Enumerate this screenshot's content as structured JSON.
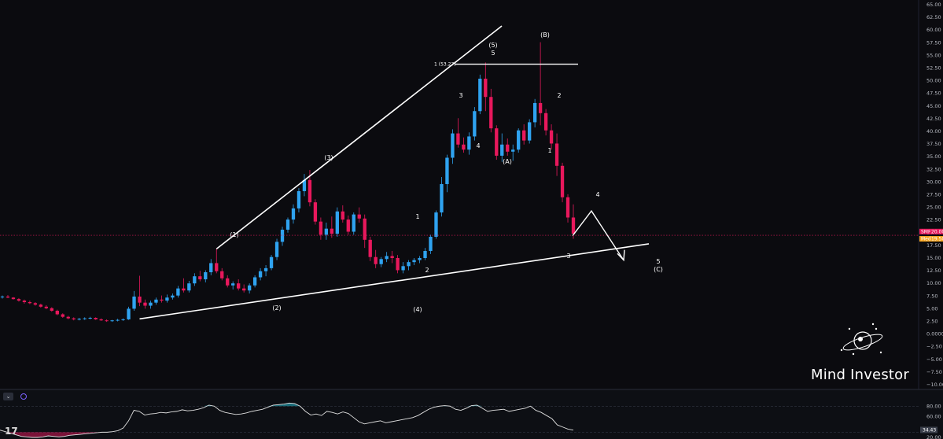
{
  "chart_data": [
    {
      "type": "candlestick",
      "ylim": [
        -10.0,
        65.0
      ],
      "y_ticks": [
        "65.00",
        "62.50",
        "60.00",
        "57.50",
        "55.00",
        "52.50",
        "50.00",
        "47.50",
        "45.00",
        "42.50",
        "40.00",
        "37.50",
        "35.00",
        "32.50",
        "30.00",
        "27.50",
        "25.00",
        "22.50",
        "20.00",
        "17.50",
        "15.00",
        "12.50",
        "10.00",
        "7.50",
        "5.00",
        "2.50",
        "0.0000",
        "−2.50",
        "−5.00",
        "−7.50",
        "−10.00"
      ],
      "up_color": "#2fa3f0",
      "down_color": "#e8185c",
      "candles": [
        [
          7.3,
          7.6,
          7.0,
          7.4
        ],
        [
          7.4,
          7.7,
          7.1,
          7.2
        ],
        [
          7.2,
          7.3,
          6.8,
          6.9
        ],
        [
          6.9,
          7.1,
          6.4,
          6.6
        ],
        [
          6.6,
          6.8,
          6.0,
          6.3
        ],
        [
          6.3,
          6.6,
          5.9,
          6.1
        ],
        [
          6.1,
          6.3,
          5.6,
          5.8
        ],
        [
          5.8,
          6.0,
          5.2,
          5.4
        ],
        [
          5.4,
          5.7,
          4.9,
          5.1
        ],
        [
          5.1,
          5.3,
          4.4,
          4.6
        ],
        [
          4.6,
          4.8,
          3.7,
          3.9
        ],
        [
          3.9,
          4.1,
          3.2,
          3.4
        ],
        [
          3.4,
          3.6,
          2.9,
          3.1
        ],
        [
          3.1,
          3.3,
          2.7,
          2.9
        ],
        [
          2.9,
          3.2,
          2.7,
          3.0
        ],
        [
          3.0,
          3.3,
          2.8,
          3.1
        ],
        [
          3.1,
          3.4,
          2.9,
          3.2
        ],
        [
          3.2,
          3.3,
          2.8,
          2.9
        ],
        [
          2.9,
          3.1,
          2.6,
          2.7
        ],
        [
          2.7,
          2.9,
          2.4,
          2.6
        ],
        [
          2.6,
          2.8,
          2.4,
          2.7
        ],
        [
          2.7,
          3.0,
          2.5,
          2.8
        ],
        [
          2.8,
          3.1,
          2.6,
          2.9
        ],
        [
          2.9,
          5.4,
          2.8,
          5.0
        ],
        [
          5.0,
          8.5,
          4.6,
          7.4
        ],
        [
          7.4,
          11.5,
          5.5,
          6.2
        ],
        [
          6.2,
          6.8,
          5.0,
          5.6
        ],
        [
          5.6,
          6.6,
          5.0,
          6.2
        ],
        [
          6.2,
          7.2,
          5.8,
          6.8
        ],
        [
          6.8,
          7.6,
          6.2,
          6.6
        ],
        [
          6.6,
          7.8,
          6.2,
          7.2
        ],
        [
          7.2,
          8.0,
          6.8,
          7.6
        ],
        [
          7.6,
          9.5,
          7.2,
          9.0
        ],
        [
          9.0,
          11.0,
          8.2,
          8.6
        ],
        [
          8.6,
          10.5,
          8.2,
          10.0
        ],
        [
          10.0,
          12.0,
          9.5,
          11.4
        ],
        [
          11.4,
          12.5,
          10.4,
          10.8
        ],
        [
          10.8,
          12.6,
          10.2,
          12.2
        ],
        [
          12.2,
          14.8,
          11.6,
          14.0
        ],
        [
          14.0,
          16.8,
          12.0,
          12.4
        ],
        [
          12.4,
          13.0,
          10.6,
          11.0
        ],
        [
          11.0,
          11.6,
          9.2,
          9.6
        ],
        [
          9.6,
          10.4,
          8.8,
          10.0
        ],
        [
          10.0,
          10.8,
          8.6,
          9.0
        ],
        [
          9.0,
          9.8,
          8.2,
          8.6
        ],
        [
          8.6,
          10.0,
          8.0,
          9.6
        ],
        [
          9.6,
          11.6,
          9.2,
          11.2
        ],
        [
          11.2,
          13.0,
          10.6,
          12.4
        ],
        [
          12.4,
          13.6,
          11.4,
          13.0
        ],
        [
          13.0,
          15.6,
          12.6,
          15.2
        ],
        [
          15.2,
          18.8,
          14.6,
          18.2
        ],
        [
          18.2,
          21.2,
          17.4,
          20.6
        ],
        [
          20.6,
          23.0,
          20.0,
          22.6
        ],
        [
          22.6,
          25.6,
          21.8,
          24.8
        ],
        [
          24.8,
          28.8,
          24.0,
          28.2
        ],
        [
          28.2,
          31.6,
          27.2,
          30.4
        ],
        [
          30.4,
          32.4,
          25.2,
          26.0
        ],
        [
          26.0,
          26.6,
          21.6,
          22.2
        ],
        [
          22.2,
          23.0,
          18.6,
          19.6
        ],
        [
          19.6,
          22.0,
          18.6,
          20.8
        ],
        [
          20.8,
          23.2,
          19.0,
          19.8
        ],
        [
          19.8,
          25.0,
          19.2,
          24.2
        ],
        [
          24.2,
          25.4,
          22.0,
          22.6
        ],
        [
          22.6,
          23.4,
          19.6,
          20.2
        ],
        [
          20.2,
          24.0,
          19.6,
          23.6
        ],
        [
          23.6,
          25.0,
          22.0,
          22.8
        ],
        [
          22.8,
          23.6,
          17.0,
          18.6
        ],
        [
          18.6,
          19.2,
          14.4,
          15.2
        ],
        [
          15.2,
          16.6,
          13.0,
          13.8
        ],
        [
          13.8,
          15.2,
          13.2,
          14.8
        ],
        [
          14.8,
          16.2,
          14.2,
          15.4
        ],
        [
          15.4,
          16.4,
          14.0,
          15.0
        ],
        [
          15.0,
          15.6,
          12.0,
          12.6
        ],
        [
          12.6,
          14.2,
          12.0,
          13.4
        ],
        [
          13.4,
          14.6,
          12.6,
          14.2
        ],
        [
          14.2,
          15.0,
          13.6,
          14.6
        ],
        [
          14.6,
          15.4,
          14.0,
          15.0
        ],
        [
          15.0,
          17.0,
          14.6,
          16.4
        ],
        [
          16.4,
          19.6,
          15.8,
          19.2
        ],
        [
          19.2,
          24.4,
          18.8,
          24.0
        ],
        [
          24.0,
          31.0,
          23.2,
          29.6
        ],
        [
          29.6,
          35.4,
          28.0,
          34.8
        ],
        [
          34.8,
          40.4,
          33.6,
          39.6
        ],
        [
          39.6,
          42.6,
          36.8,
          37.4
        ],
        [
          37.4,
          38.8,
          35.8,
          36.4
        ],
        [
          36.4,
          39.8,
          35.4,
          39.0
        ],
        [
          39.0,
          44.8,
          38.2,
          44.0
        ],
        [
          44.0,
          51.2,
          43.4,
          50.4
        ],
        [
          50.4,
          53.6,
          44.0,
          46.8
        ],
        [
          46.8,
          48.4,
          39.8,
          40.6
        ],
        [
          40.6,
          41.2,
          34.4,
          35.2
        ],
        [
          35.2,
          39.6,
          34.0,
          37.4
        ],
        [
          37.4,
          38.6,
          35.2,
          36.0
        ],
        [
          36.0,
          37.4,
          34.2,
          36.4
        ],
        [
          36.4,
          40.6,
          35.8,
          40.2
        ],
        [
          40.2,
          41.4,
          37.4,
          38.2
        ],
        [
          38.2,
          42.4,
          37.6,
          41.8
        ],
        [
          41.8,
          46.4,
          40.8,
          45.6
        ],
        [
          45.6,
          57.6,
          41.2,
          43.6
        ],
        [
          43.6,
          44.4,
          39.2,
          40.2
        ],
        [
          40.2,
          41.4,
          36.4,
          37.6
        ],
        [
          37.6,
          39.6,
          31.2,
          33.2
        ],
        [
          33.2,
          33.8,
          26.0,
          27.0
        ],
        [
          27.0,
          27.6,
          22.0,
          23.0
        ],
        [
          23.0,
          25.6,
          18.8,
          19.8
        ]
      ],
      "wave_labels": [
        "(1)",
        "(2)",
        "(3)",
        "(4)",
        "(5)",
        "5",
        "3",
        "4",
        "(A)",
        "(B)",
        "2",
        "1",
        "1",
        "2",
        "3",
        "4",
        "5",
        "(C)"
      ],
      "fib_label": "1 (53.27)",
      "price_badges": [
        {
          "label": "SMF",
          "value": "20.00",
          "color": "#e8185c"
        },
        {
          "label": "Med",
          "value": "19.50",
          "color": "#f5a623"
        }
      ],
      "line_color": "#ffffff"
    },
    {
      "type": "line",
      "title": "",
      "ylim": [
        20,
        100
      ],
      "y_ticks": [
        "80.00",
        "60.00",
        "20.00"
      ],
      "last_value_label": "34.43",
      "line_color": "#e0e0e0",
      "overbought_color": "#26c6da",
      "oversold_color": "#e8185c",
      "values": [
        34,
        31,
        28,
        25,
        22,
        21,
        20,
        20,
        21,
        23,
        22,
        21,
        22,
        24,
        25,
        26,
        27,
        28,
        29,
        30,
        30,
        31,
        33,
        38,
        52,
        72,
        70,
        63,
        65,
        66,
        68,
        67,
        69,
        70,
        73,
        71,
        72,
        74,
        77,
        82,
        80,
        72,
        68,
        66,
        64,
        65,
        67,
        70,
        72,
        74,
        78,
        82,
        83,
        84,
        86,
        85,
        80,
        70,
        63,
        65,
        62,
        70,
        68,
        65,
        69,
        66,
        58,
        50,
        46,
        48,
        50,
        52,
        48,
        50,
        52,
        54,
        56,
        58,
        62,
        68,
        74,
        78,
        80,
        81,
        80,
        74,
        72,
        76,
        81,
        82,
        76,
        70,
        72,
        73,
        74,
        70,
        72,
        74,
        76,
        80,
        72,
        68,
        62,
        56,
        44,
        40,
        36,
        34
      ]
    }
  ],
  "brand": {
    "name": "Mind Investor"
  },
  "toolbar": {
    "collapse_icon": "chevron-down-icon",
    "indicator_icon": "indicator-icon",
    "logo_text": "17"
  }
}
